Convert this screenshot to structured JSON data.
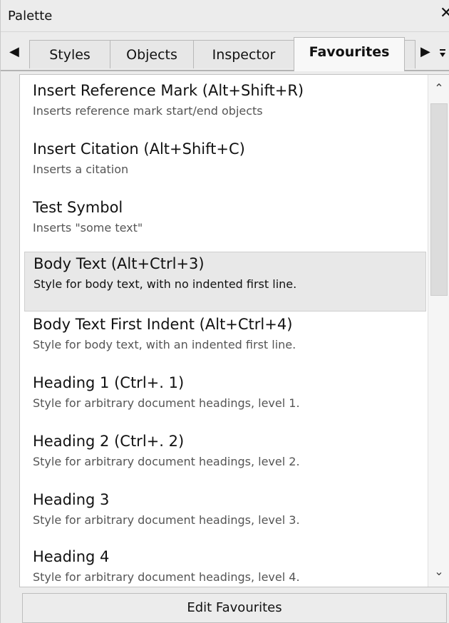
{
  "window": {
    "title": "Palette",
    "close_glyph": "✕"
  },
  "tabs": [
    {
      "label": "Styles",
      "active": false
    },
    {
      "label": "Objects",
      "active": false
    },
    {
      "label": "Inspector",
      "active": false
    },
    {
      "label": "Favourites",
      "active": true
    },
    {
      "label": "",
      "active": false
    }
  ],
  "tab_scroll": {
    "left_icon": "chevron-left-icon",
    "right_icon": "chevron-right-icon",
    "menu_icon": "menu-dropdown-icon"
  },
  "favourites": [
    {
      "name": "Insert Reference Mark (Alt+Shift+R)",
      "description": "Inserts reference mark start/end objects",
      "selected": false
    },
    {
      "name": "Insert Citation (Alt+Shift+C)",
      "description": "Inserts a citation",
      "selected": false
    },
    {
      "name": "Test Symbol",
      "description": "Inserts \"some text\"",
      "selected": false
    },
    {
      "name": "Body Text (Alt+Ctrl+3)",
      "description": "Style for body text, with no indented first line.",
      "selected": true
    },
    {
      "name": "Body Text First Indent (Alt+Ctrl+4)",
      "description": "Style for body text, with an indented first line.",
      "selected": false
    },
    {
      "name": "Heading 1 (Ctrl+. 1)",
      "description": "Style for arbitrary document headings, level 1.",
      "selected": false
    },
    {
      "name": "Heading 2 (Ctrl+. 2)",
      "description": "Style for arbitrary document headings, level 2.",
      "selected": false
    },
    {
      "name": "Heading 3",
      "description": "Style for arbitrary document headings, level 3.",
      "selected": false
    },
    {
      "name": "Heading 4",
      "description": "Style for arbitrary document headings, level 4.",
      "selected": false
    }
  ],
  "footer": {
    "edit_label": "Edit Favourites"
  },
  "colors": {
    "panel_background": "#ececec",
    "list_background": "#ffffff",
    "selected_row": "#e8e8e8",
    "description_text": "#555555"
  }
}
